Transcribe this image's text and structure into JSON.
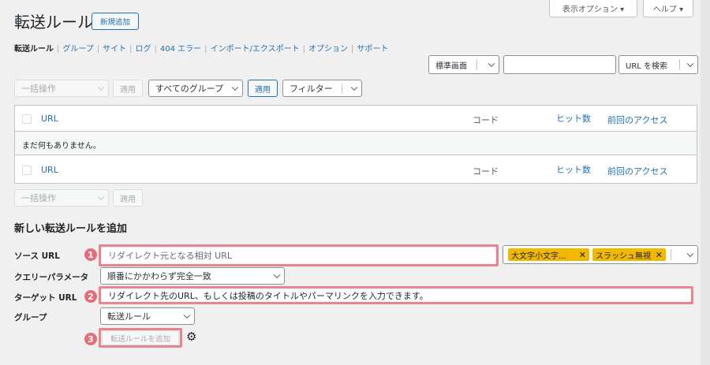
{
  "page": {
    "title": "転送ルール",
    "add_new": "新規追加"
  },
  "screen_options": {
    "label": "表示オプション ▾",
    "help": "ヘルプ ▾"
  },
  "nav": {
    "items": [
      {
        "label": "転送ルール",
        "active": true
      },
      {
        "label": "グループ"
      },
      {
        "label": "サイト"
      },
      {
        "label": "ログ"
      },
      {
        "label": "404 エラー"
      },
      {
        "label": "インポート/エクスポート"
      },
      {
        "label": "オプション"
      },
      {
        "label": "サポート"
      }
    ],
    "separator": "|"
  },
  "search": {
    "mode": "標準画面",
    "value": "",
    "button": "URL を検索"
  },
  "toolbar_top": {
    "bulk": "一括操作",
    "apply": "適用",
    "group_filter": "すべてのグループ",
    "group_apply": "適用",
    "filter": "フィルター"
  },
  "table": {
    "columns": {
      "url": "URL",
      "code": "コード",
      "hits": "ヒット数",
      "last_access": "前回のアクセス"
    },
    "empty": "まだ何もありません。"
  },
  "toolbar_bottom": {
    "bulk": "一括操作",
    "apply": "適用"
  },
  "form": {
    "heading": "新しい転送ルールを追加",
    "source_label": "ソース URL",
    "source_placeholder": "リダイレクト元となる相対 URL",
    "tags": [
      "大文字小文字...",
      "スラッシュ無視"
    ],
    "tag_remove": "✕",
    "query_label": "クエリーパラメータ",
    "query_value": "順番にかかわらず完全一致",
    "target_label": "ターゲット URL",
    "target_placeholder": "リダイレクト先のURL、もしくは投稿のタイトルやパーマリンクを入力できます。",
    "group_label": "グループ",
    "group_value": "転送ルール",
    "submit": "転送ルールを追加",
    "gear": "⚙"
  },
  "badges": [
    "1",
    "2",
    "3"
  ],
  "colors": {
    "accent": "#2271b1",
    "highlight": "#e8848c",
    "badge": "#e36d78",
    "tag": "#f0b800"
  }
}
